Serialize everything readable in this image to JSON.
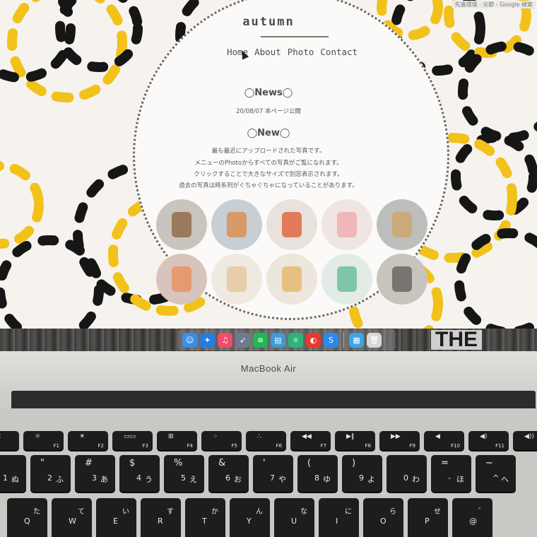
{
  "browser_tab_hint": "先進環境 · 尖節 - Google 検索",
  "site": {
    "title": "autumn",
    "nav": [
      "Home",
      "About",
      "Photo",
      "Contact"
    ],
    "news_heading": "◯News◯",
    "news_item": "20/08/07 本ページ公開",
    "new_heading": "◯New◯",
    "new_lines": [
      "最も最近にアップロードされた写真です。",
      "メニューのPhotoからすべての写真がご覧になれます。",
      "クリックすることで大きなサイズで別窓表示されます。",
      "過去の写真は時系列がぐちゃぐちゃになっていることがあります。"
    ]
  },
  "thumbnails": [
    {
      "icon": "photo-wood-figure",
      "bg": "#c9c4bd",
      "fg": "#9a7a5a"
    },
    {
      "icon": "photo-iced-drink",
      "bg": "#c7cfd4",
      "fg": "#d89a66"
    },
    {
      "icon": "photo-red-toy",
      "bg": "#e9e2dc",
      "fg": "#e27b5c"
    },
    {
      "icon": "photo-pink-figure",
      "bg": "#efe6e3",
      "fg": "#f0b6b9"
    },
    {
      "icon": "photo-latte-cup",
      "bg": "#bcbfbb",
      "fg": "#caa97a"
    },
    {
      "icon": "photo-orange-drink",
      "bg": "#d7c4bb",
      "fg": "#e59a6f"
    },
    {
      "icon": "photo-paper-bird",
      "bg": "#efe9e2",
      "fg": "#e8cda9"
    },
    {
      "icon": "photo-origami-bird",
      "bg": "#ece6dc",
      "fg": "#e6c081"
    },
    {
      "icon": "photo-origami-green",
      "bg": "#e3ebe6",
      "fg": "#7fc6a9"
    },
    {
      "icon": "photo-dark-sign",
      "bg": "#c8c3bd",
      "fg": "#7a7470"
    }
  ],
  "dock": {
    "apps": [
      {
        "icon": "finder-icon",
        "glyph": "☺",
        "color": "#3a8ee6"
      },
      {
        "icon": "safari-icon",
        "glyph": "✦",
        "color": "#2a7be0"
      },
      {
        "icon": "music-icon",
        "glyph": "♫",
        "color": "#f04b6a"
      },
      {
        "icon": "launchpad-icon",
        "glyph": "➶",
        "color": "#6d7b8c"
      },
      {
        "icon": "spotify-icon",
        "glyph": "≋",
        "color": "#1db954"
      },
      {
        "icon": "notes-icon",
        "glyph": "▤",
        "color": "#3d9ad6"
      },
      {
        "icon": "atom-icon",
        "glyph": "⚛",
        "color": "#2bb37a"
      },
      {
        "icon": "red-app-icon",
        "glyph": "◐",
        "color": "#e8392f"
      },
      {
        "icon": "shazam-icon",
        "glyph": "S",
        "color": "#2a8ae8"
      }
    ],
    "right_apps": [
      {
        "icon": "downloads-icon",
        "glyph": "▦",
        "color": "#3ea4e8"
      },
      {
        "icon": "trash-icon",
        "glyph": "🗑",
        "color": "#d8d8d8"
      }
    ],
    "background_text": "THE"
  },
  "laptop": {
    "brand": "MacBook Air"
  },
  "keyboard": {
    "function_row": [
      {
        "icon": "esc",
        "label": ""
      },
      {
        "icon": "☼",
        "label": "F1"
      },
      {
        "icon": "☀",
        "label": "F2"
      },
      {
        "icon": "▭▭",
        "label": "F3"
      },
      {
        "icon": "⊞",
        "label": "F4"
      },
      {
        "icon": "⁘",
        "label": "F5"
      },
      {
        "icon": "∴",
        "label": "F6"
      },
      {
        "icon": "◀◀",
        "label": "F7"
      },
      {
        "icon": "▶‖",
        "label": "F8"
      },
      {
        "icon": "▶▶",
        "label": "F9"
      },
      {
        "icon": "◀",
        "label": "F10"
      },
      {
        "icon": "◀)",
        "label": "F11"
      },
      {
        "icon": "◀))",
        "label": "F12"
      }
    ],
    "number_row": [
      {
        "top": "!",
        "main": "1",
        "kana": "ぬ"
      },
      {
        "top": "\"",
        "main": "2",
        "kana": "ふ"
      },
      {
        "top": "#",
        "main": "3",
        "kana": "あ"
      },
      {
        "top": "$",
        "main": "4",
        "kana": "う"
      },
      {
        "top": "%",
        "main": "5",
        "kana": "え"
      },
      {
        "top": "&",
        "main": "6",
        "kana": "お"
      },
      {
        "top": "'",
        "main": "7",
        "kana": "や"
      },
      {
        "top": "(",
        "main": "8",
        "kana": "ゆ"
      },
      {
        "top": ")",
        "main": "9",
        "kana": "よ"
      },
      {
        "top": "",
        "main": "0",
        "kana": "わ"
      },
      {
        "top": "=",
        "main": "-",
        "kana": "ほ"
      },
      {
        "top": "~",
        "main": "^",
        "kana": "へ"
      }
    ],
    "qwerty_row": [
      {
        "main": "Q",
        "kana": "た"
      },
      {
        "main": "W",
        "kana": "て"
      },
      {
        "main": "E",
        "kana": "い"
      },
      {
        "main": "R",
        "kana": "す"
      },
      {
        "main": "T",
        "kana": "か"
      },
      {
        "main": "Y",
        "kana": "ん"
      },
      {
        "main": "U",
        "kana": "な"
      },
      {
        "main": "I",
        "kana": "に"
      },
      {
        "main": "O",
        "kana": "ら"
      },
      {
        "main": "P",
        "kana": "せ"
      },
      {
        "main": "@",
        "kana": "゛"
      }
    ]
  }
}
